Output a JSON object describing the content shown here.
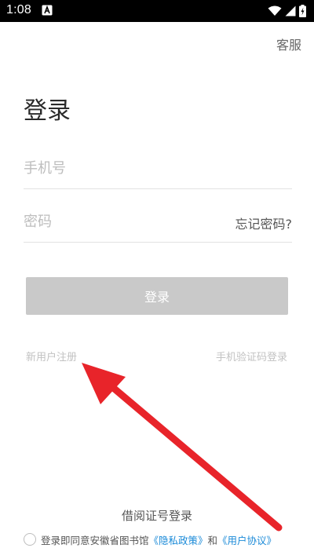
{
  "status_bar": {
    "time": "1:08",
    "icons": [
      "notification-a-icon",
      "wifi-icon",
      "signal-icon",
      "battery-charging-icon"
    ]
  },
  "header": {
    "service_label": "客服"
  },
  "title": "登录",
  "form": {
    "phone_placeholder": "手机号",
    "password_placeholder": "密码",
    "forgot_label": "忘记密码?",
    "submit_label": "登录"
  },
  "links": {
    "register": "新用户注册",
    "sms_login": "手机验证码登录",
    "card_login": "借阅证号登录"
  },
  "agreement": {
    "prefix": "登录即同意安徽省图书馆",
    "privacy_policy": "《隐私政策》",
    "conjunction": "和",
    "user_agreement": "《用户协议》"
  },
  "colors": {
    "button_disabled": "#c9c9c9",
    "link_blue": "#1a8ad8",
    "annotation_arrow": "#e8242a"
  }
}
